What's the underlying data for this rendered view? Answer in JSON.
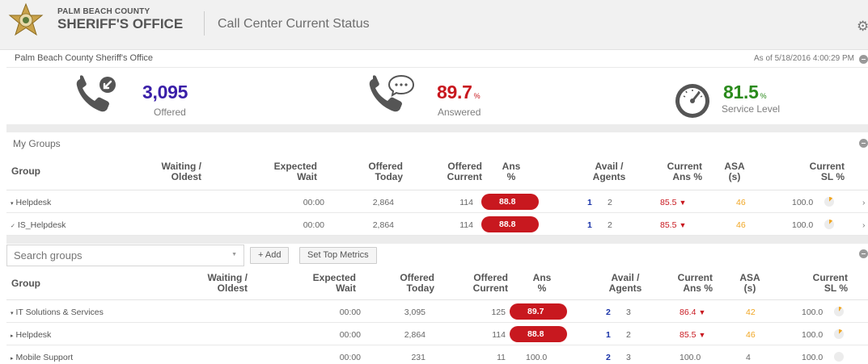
{
  "header": {
    "org_small": "PALM BEACH COUNTY",
    "org_big": "SHERIFF'S OFFICE",
    "title": "Call Center Current Status",
    "settings_icon": "gear-icon"
  },
  "summary": {
    "name": "Palm Beach County Sheriff's Office",
    "as_of": "As of 5/18/2016 4:00:29 PM",
    "offered": {
      "value": "3,095",
      "label": "Offered",
      "color": "#3a1fa8"
    },
    "answered": {
      "value": "89.7",
      "unit": "%",
      "label": "Answered",
      "color": "#c8181f"
    },
    "service_level": {
      "value": "81.5",
      "unit": "%",
      "label": "Service Level",
      "color": "#2a8a1c"
    }
  },
  "my_groups": {
    "title": "My Groups",
    "columns": [
      "Group",
      "Waiting /",
      "Oldest",
      "Expected",
      "Wait",
      "Offered",
      "Today",
      "Offered",
      "Current",
      "Ans",
      "%",
      "Avail /",
      "Agents",
      "Current",
      "Ans %",
      "ASA",
      "(s)",
      "Current",
      "SL %"
    ],
    "rows": [
      {
        "name": "Helpdesk",
        "prefix": "▾",
        "expected": "00:00",
        "today": "2,864",
        "current": "114",
        "ans": "88.8",
        "avail": "1",
        "agents": "2",
        "cur_ans": "85.5",
        "asa": "46",
        "sl": "100.0",
        "sl_fraction": 0.12
      },
      {
        "name": "IS_Helpdesk",
        "prefix": "✓",
        "expected": "00:00",
        "today": "2,864",
        "current": "114",
        "ans": "88.8",
        "avail": "1",
        "agents": "2",
        "cur_ans": "85.5",
        "asa": "46",
        "sl": "100.0",
        "sl_fraction": 0.12
      }
    ]
  },
  "toolbar": {
    "search_placeholder": "Search groups",
    "add_label": "+ Add",
    "metrics_label": "Set Top Metrics"
  },
  "all_groups": {
    "rows": [
      {
        "name": "IT Solutions & Services",
        "prefix": "▾",
        "expected": "00:00",
        "today": "3,095",
        "current": "125",
        "ans": "89.7",
        "ans_pill": true,
        "avail": "2",
        "agents": "3",
        "cur_ans": "86.4",
        "cur_red": true,
        "asa": "42",
        "asa_orange": true,
        "sl": "100.0",
        "sl_fraction": 0.1
      },
      {
        "name": "Helpdesk",
        "prefix": "▸",
        "expected": "00:00",
        "today": "2,864",
        "current": "114",
        "ans": "88.8",
        "ans_pill": true,
        "avail": "1",
        "agents": "2",
        "cur_ans": "85.5",
        "cur_red": true,
        "asa": "46",
        "asa_orange": true,
        "sl": "100.0",
        "sl_fraction": 0.12
      },
      {
        "name": "Mobile Support",
        "prefix": "▸",
        "expected": "00:00",
        "today": "231",
        "current": "11",
        "ans": "100.0",
        "ans_pill": false,
        "avail": "2",
        "agents": "3",
        "cur_ans": "100.0",
        "cur_red": false,
        "asa": "4",
        "asa_orange": false,
        "sl": "100.0",
        "sl_fraction": 0
      }
    ]
  }
}
